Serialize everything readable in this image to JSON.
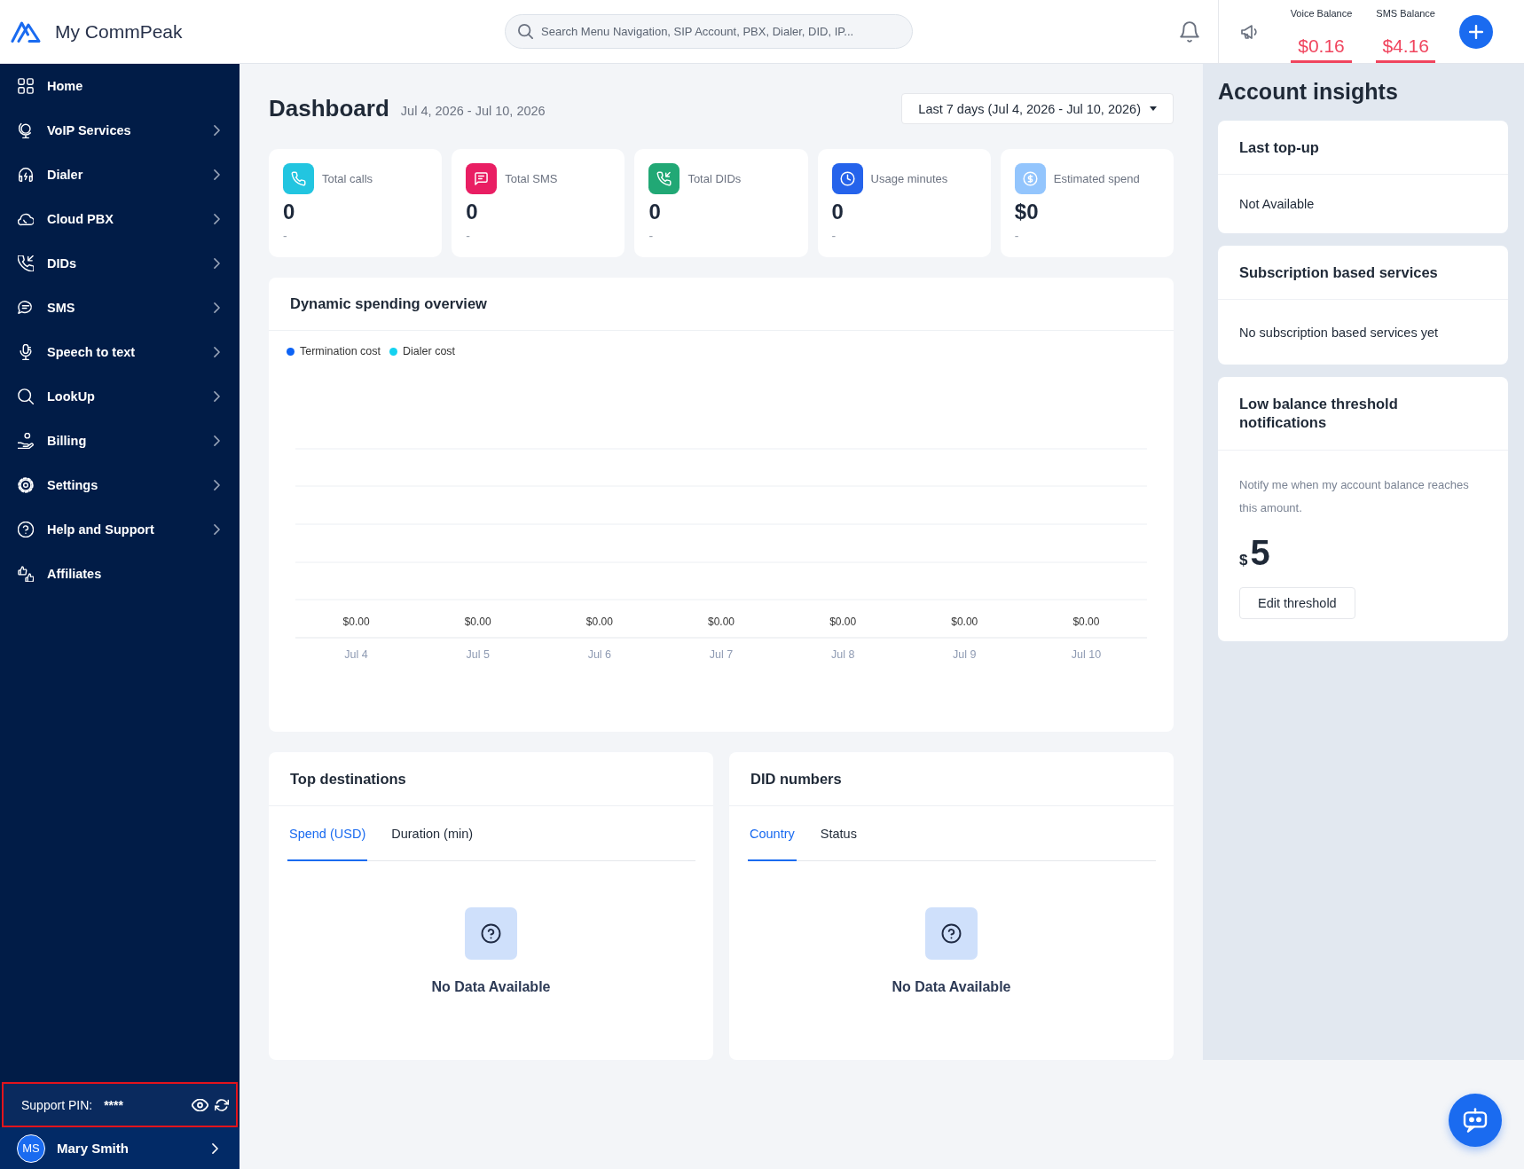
{
  "top_bar": {
    "logo_text": "My CommPeak",
    "search": {
      "placeholder": "Search Menu Navigation, SIP Account, PBX, Dialer, DID, IP..."
    },
    "balances": [
      {
        "label": "Voice Balance",
        "amount": "$0.16"
      },
      {
        "label": "SMS Balance",
        "amount": "$4.16"
      }
    ]
  },
  "sidebar": {
    "items": [
      {
        "label": "Home",
        "has_submenu": false,
        "selected": false
      },
      {
        "label": "VoIP Services",
        "has_submenu": true,
        "selected": false
      },
      {
        "label": "Dialer",
        "has_submenu": true,
        "selected": false
      },
      {
        "label": "Cloud PBX",
        "has_submenu": true,
        "selected": false
      },
      {
        "label": "DIDs",
        "has_submenu": true,
        "selected": false
      },
      {
        "label": "SMS",
        "has_submenu": true,
        "selected": false
      },
      {
        "label": "Speech to text",
        "has_submenu": true,
        "selected": false
      },
      {
        "label": "LookUp",
        "has_submenu": true,
        "selected": false
      },
      {
        "label": "Billing",
        "has_submenu": true,
        "selected": false
      },
      {
        "label": "Settings",
        "has_submenu": true,
        "selected": false
      },
      {
        "label": "Help and Support",
        "has_submenu": true,
        "selected": false
      },
      {
        "label": "Affiliates",
        "has_submenu": false,
        "selected": false
      }
    ],
    "support_pin": {
      "label": "Support PIN:",
      "value": "****",
      "highlighted": true
    },
    "user": {
      "initials": "MS",
      "name": "Mary Smith"
    }
  },
  "dashboard": {
    "title": "Dashboard",
    "date_range": "Jul 4, 2026 - Jul 10, 2026",
    "period_dropdown": "Last 7 days (Jul 4, 2026 - Jul 10, 2026)",
    "stats": [
      {
        "label": "Total calls",
        "value": "0",
        "subtext": "-",
        "color": "#22c5e0"
      },
      {
        "label": "Total SMS",
        "value": "0",
        "subtext": "-",
        "color": "#e91e63"
      },
      {
        "label": "Total DIDs",
        "value": "0",
        "subtext": "-",
        "color": "#21a875"
      },
      {
        "label": "Usage minutes",
        "value": "0",
        "subtext": "-",
        "color": "#2563eb"
      },
      {
        "label": "Estimated spend",
        "value": "$0",
        "subtext": "-",
        "color": "#93c5fd"
      }
    ],
    "spending_chart": {
      "title": "Dynamic spending overview",
      "legend": [
        {
          "label": "Termination cost",
          "color": "#0d63f5"
        },
        {
          "label": "Dialer cost",
          "color": "#14d2f0"
        }
      ],
      "days": [
        {
          "label": "Jul 4",
          "total": "$0.00"
        },
        {
          "label": "Jul 5",
          "total": "$0.00"
        },
        {
          "label": "Jul 6",
          "total": "$0.00"
        },
        {
          "label": "Jul 7",
          "total": "$0.00"
        },
        {
          "label": "Jul 8",
          "total": "$0.00"
        },
        {
          "label": "Jul 9",
          "total": "$0.00"
        },
        {
          "label": "Jul 10",
          "total": "$0.00"
        }
      ]
    },
    "top_destinations": {
      "title": "Top destinations",
      "tabs": [
        {
          "label": "Spend (USD)",
          "selected": true
        },
        {
          "label": "Duration (min)",
          "selected": false
        }
      ],
      "empty_message": "No Data Available"
    },
    "did_numbers": {
      "title": "DID numbers",
      "tabs": [
        {
          "label": "Country",
          "selected": true
        },
        {
          "label": "Status",
          "selected": false
        }
      ],
      "empty_message": "No Data Available"
    }
  },
  "account_insights": {
    "title": "Account insights",
    "last_top_up": {
      "title": "Last top-up",
      "value": "Not Available"
    },
    "subscriptions": {
      "title": "Subscription based services",
      "message": "No subscription based services yet"
    },
    "low_balance": {
      "title": "Low balance threshold notifications",
      "description": "Notify me when my account balance reaches this amount.",
      "currency": "$",
      "amount": "5",
      "button": "Edit threshold"
    }
  }
}
